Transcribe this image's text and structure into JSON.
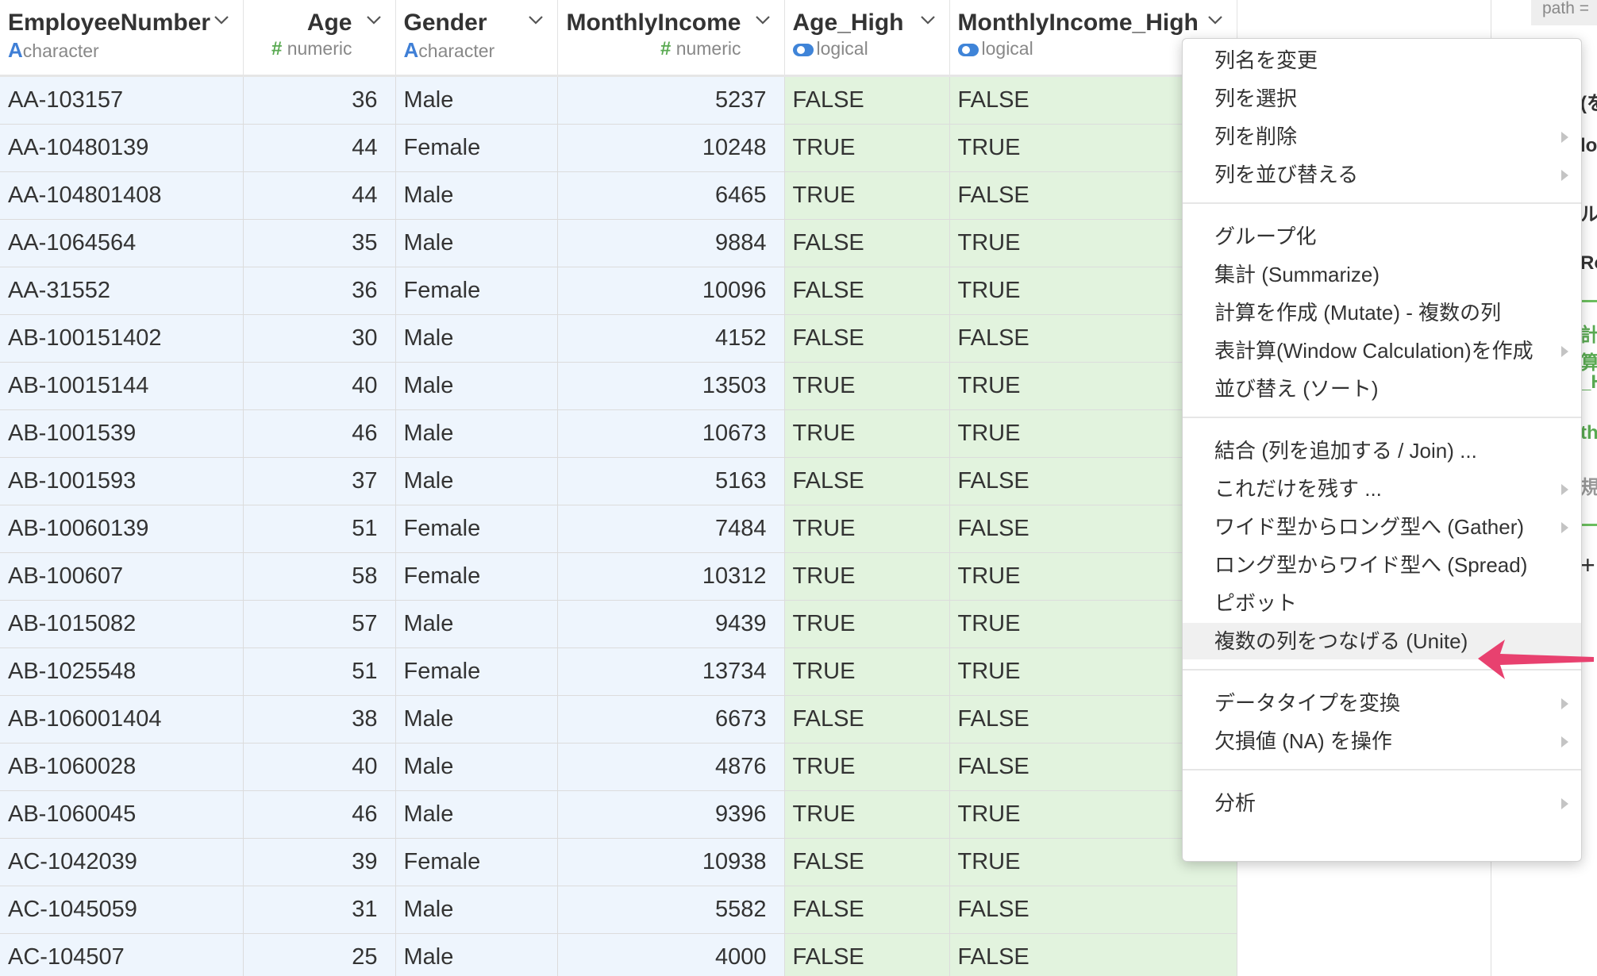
{
  "table": {
    "columns": [
      {
        "name": "EmployeeNumber",
        "type_icon": "character-icon",
        "type_glyph": "A",
        "type": "character"
      },
      {
        "name": "Age",
        "type_icon": "numeric-icon",
        "type_glyph": "#",
        "type": "numeric"
      },
      {
        "name": "Gender",
        "type_icon": "character-icon",
        "type_glyph": "A",
        "type": "character"
      },
      {
        "name": "MonthlyIncome",
        "type_icon": "numeric-icon",
        "type_glyph": "#",
        "type": "numeric"
      },
      {
        "name": "Age_High",
        "type_icon": "logical-icon",
        "type": "logical"
      },
      {
        "name": "MonthlyIncome_High",
        "type_icon": "logical-icon",
        "type": "logical"
      }
    ],
    "rows": [
      [
        "AA-103157",
        "36",
        "Male",
        "5237",
        "FALSE",
        "FALSE"
      ],
      [
        "AA-10480139",
        "44",
        "Female",
        "10248",
        "TRUE",
        "TRUE"
      ],
      [
        "AA-104801408",
        "44",
        "Male",
        "6465",
        "TRUE",
        "FALSE"
      ],
      [
        "AA-1064564",
        "35",
        "Male",
        "9884",
        "FALSE",
        "TRUE"
      ],
      [
        "AA-31552",
        "36",
        "Female",
        "10096",
        "FALSE",
        "TRUE"
      ],
      [
        "AB-100151402",
        "30",
        "Male",
        "4152",
        "FALSE",
        "FALSE"
      ],
      [
        "AB-10015144",
        "40",
        "Male",
        "13503",
        "TRUE",
        "TRUE"
      ],
      [
        "AB-1001539",
        "46",
        "Male",
        "10673",
        "TRUE",
        "TRUE"
      ],
      [
        "AB-1001593",
        "37",
        "Male",
        "5163",
        "FALSE",
        "FALSE"
      ],
      [
        "AB-10060139",
        "51",
        "Female",
        "7484",
        "TRUE",
        "FALSE"
      ],
      [
        "AB-100607",
        "58",
        "Female",
        "10312",
        "TRUE",
        "TRUE"
      ],
      [
        "AB-1015082",
        "57",
        "Male",
        "9439",
        "TRUE",
        "TRUE"
      ],
      [
        "AB-1025548",
        "51",
        "Female",
        "13734",
        "TRUE",
        "TRUE"
      ],
      [
        "AB-106001404",
        "38",
        "Male",
        "6673",
        "FALSE",
        "FALSE"
      ],
      [
        "AB-1060028",
        "40",
        "Male",
        "4876",
        "TRUE",
        "FALSE"
      ],
      [
        "AB-1060045",
        "46",
        "Male",
        "9396",
        "TRUE",
        "TRUE"
      ],
      [
        "AC-1042039",
        "39",
        "Female",
        "10938",
        "FALSE",
        "TRUE"
      ],
      [
        "AC-1045059",
        "31",
        "Male",
        "5582",
        "FALSE",
        "FALSE"
      ],
      [
        "AC-104507",
        "25",
        "Male",
        "4000",
        "FALSE",
        "FALSE"
      ]
    ]
  },
  "context_menu": {
    "groups": [
      [
        {
          "label": "列名を変更",
          "submenu": false
        },
        {
          "label": "列を選択",
          "submenu": false
        },
        {
          "label": "列を削除",
          "submenu": true
        },
        {
          "label": "列を並び替える",
          "submenu": true
        }
      ],
      [
        {
          "label": "グループ化",
          "submenu": false
        },
        {
          "label": "集計 (Summarize)",
          "submenu": false
        },
        {
          "label": "計算を作成 (Mutate) - 複数の列",
          "submenu": false
        },
        {
          "label": "表計算(Window Calculation)を作成",
          "submenu": true
        },
        {
          "label": "並び替え (ソート)",
          "submenu": false
        }
      ],
      [
        {
          "label": "結合 (列を追加する / Join) ...",
          "submenu": false
        },
        {
          "label": "これだけを残す ...",
          "submenu": true
        },
        {
          "label": "ワイド型からロング型へ (Gather)",
          "submenu": true
        },
        {
          "label": "ロング型からワイド型へ (Spread)",
          "submenu": false
        },
        {
          "label": "ピボット",
          "submenu": false
        },
        {
          "label": "複数の列をつなげる (Unite)",
          "submenu": false,
          "highlighted": true
        }
      ],
      [
        {
          "label": "データタイプを変換",
          "submenu": true
        },
        {
          "label": "欠損値 (NA) を操作",
          "submenu": true
        }
      ],
      [
        {
          "label": "分析",
          "submenu": true
        }
      ]
    ]
  },
  "right_pane": {
    "chip": "path =",
    "fragments": [
      "(を",
      "lo",
      "ル",
      "Ro",
      "計算",
      "_H",
      "th",
      "規",
      "+"
    ]
  },
  "annotation": {
    "arrow_color": "#e8416f"
  }
}
